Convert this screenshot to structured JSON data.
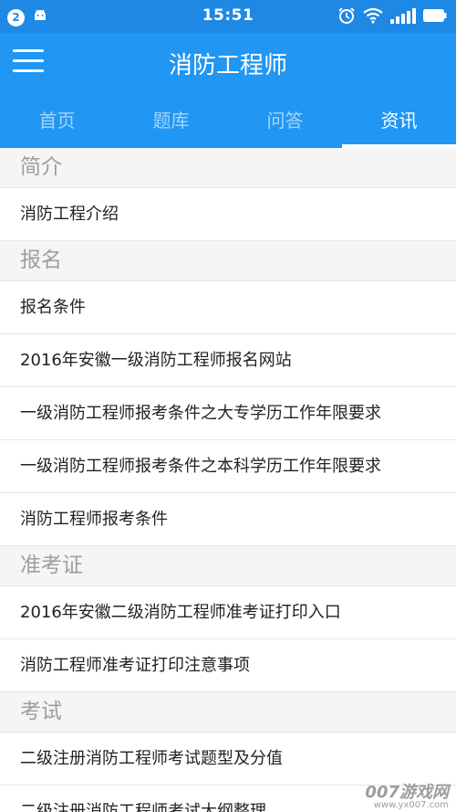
{
  "status_bar": {
    "notification_count": "2",
    "time": "15:51",
    "battery_color": "#ffffff"
  },
  "app_bar": {
    "title": "消防工程师",
    "menu_icon": "hamburger-menu-icon"
  },
  "tabs": [
    {
      "label": "首页",
      "active": false
    },
    {
      "label": "题库",
      "active": false
    },
    {
      "label": "问答",
      "active": false
    },
    {
      "label": "资讯",
      "active": true
    }
  ],
  "sections": [
    {
      "header": "简介",
      "items": [
        "消防工程介绍"
      ]
    },
    {
      "header": "报名",
      "items": [
        "报名条件",
        "2016年安徽一级消防工程师报名网站",
        "一级消防工程师报考条件之大专学历工作年限要求",
        "一级消防工程师报考条件之本科学历工作年限要求",
        "消防工程师报考条件"
      ]
    },
    {
      "header": "准考证",
      "items": [
        "2016年安徽二级消防工程师准考证打印入口",
        "消防工程师准考证打印注意事项"
      ]
    },
    {
      "header": "考试",
      "items": [
        "二级注册消防工程师考试题型及分值",
        "二级注册消防工程师考试大纲整理"
      ]
    }
  ],
  "watermark": {
    "main": "007游戏网",
    "url": "www.yx007.com"
  },
  "colors": {
    "primary": "#2196f3",
    "status_bar": "#1e88e5",
    "section_bg": "#f5f5f5"
  }
}
